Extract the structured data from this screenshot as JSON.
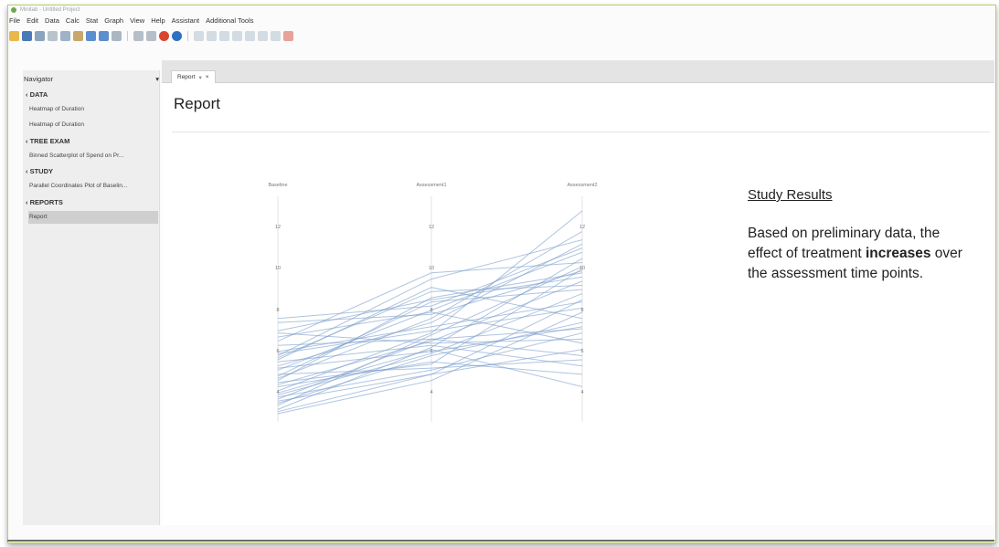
{
  "window": {
    "title": "Minitab - Untitled Project"
  },
  "menu": [
    "File",
    "Edit",
    "Data",
    "Calc",
    "Stat",
    "Graph",
    "View",
    "Help",
    "Assistant",
    "Additional Tools"
  ],
  "navigator": {
    "header": "Navigator",
    "sections": [
      {
        "label": "DATA",
        "items": [
          "Heatmap of Duration",
          "Heatmap of Duration"
        ]
      },
      {
        "label": "TREE EXAM",
        "items": [
          "Binned Scatterplot of Spend on Pr..."
        ]
      },
      {
        "label": "STUDY",
        "items": [
          "Parallel Coordinates Plot of Baselin..."
        ]
      },
      {
        "label": "REPORTS",
        "items": [
          "Report"
        ]
      }
    ],
    "selected": "Report"
  },
  "tab": {
    "label": "Report",
    "close": "×"
  },
  "report": {
    "title": "Report",
    "study_heading": "Study Results",
    "text_before": "Based on preliminary data, the effect of treatment ",
    "text_bold": "increases",
    "text_after": " over the assessment time points."
  },
  "colors": {
    "line": "#7a9ccc",
    "accent_border": "#b7cf6a"
  },
  "chart_data": {
    "type": "parallel-coordinates",
    "axes": [
      "Baseline",
      "Assessment1",
      "Assessment2"
    ],
    "ticks": [
      4,
      6,
      8,
      10,
      12
    ],
    "ylim": [
      2.6,
      13.5
    ],
    "series": [
      {
        "values": [
          4.1,
          6.9,
          12.8
        ]
      },
      {
        "values": [
          3.2,
          6.2,
          10.5
        ]
      },
      {
        "values": [
          5.8,
          9.5,
          11.4
        ]
      },
      {
        "values": [
          3.6,
          4.9,
          6.1
        ]
      },
      {
        "values": [
          4.6,
          8.6,
          9.8
        ]
      },
      {
        "values": [
          5.3,
          7.4,
          11.2
        ]
      },
      {
        "values": [
          3.9,
          5.9,
          8.8
        ]
      },
      {
        "values": [
          6.3,
          6.6,
          7.1
        ]
      },
      {
        "values": [
          4.9,
          5.2,
          5.6
        ]
      },
      {
        "values": [
          3.4,
          6.8,
          10.1
        ]
      },
      {
        "values": [
          7.6,
          8.2,
          11.0
        ]
      },
      {
        "values": [
          5.6,
          9.1,
          7.6
        ]
      },
      {
        "values": [
          4.3,
          5.5,
          4.9
        ]
      },
      {
        "values": [
          6.7,
          7.9,
          6.4
        ]
      },
      {
        "values": [
          3.0,
          4.6,
          7.9
        ]
      },
      {
        "values": [
          5.1,
          8.0,
          10.8
        ]
      },
      {
        "values": [
          4.4,
          6.5,
          9.4
        ]
      },
      {
        "values": [
          6.0,
          7.2,
          8.4
        ]
      },
      {
        "values": [
          3.8,
          5.1,
          6.9
        ]
      },
      {
        "values": [
          5.5,
          6.3,
          5.3
        ]
      },
      {
        "values": [
          7.0,
          8.5,
          9.6
        ]
      },
      {
        "values": [
          4.7,
          7.6,
          11.8
        ]
      },
      {
        "values": [
          3.5,
          5.8,
          7.4
        ]
      },
      {
        "values": [
          6.5,
          9.8,
          10.3
        ]
      },
      {
        "values": [
          4.0,
          6.1,
          4.3
        ]
      },
      {
        "values": [
          5.9,
          7.0,
          8.1
        ]
      },
      {
        "values": [
          3.1,
          4.9,
          8.5
        ]
      },
      {
        "values": [
          6.9,
          6.4,
          6.6
        ]
      },
      {
        "values": [
          4.8,
          8.4,
          9.0
        ]
      },
      {
        "values": [
          5.2,
          6.0,
          7.2
        ]
      },
      {
        "values": [
          3.7,
          6.6,
          5.8
        ]
      },
      {
        "values": [
          7.4,
          7.8,
          9.9
        ]
      },
      {
        "values": [
          4.5,
          5.4,
          10.0
        ]
      },
      {
        "values": [
          5.7,
          8.9,
          9.2
        ]
      }
    ]
  }
}
